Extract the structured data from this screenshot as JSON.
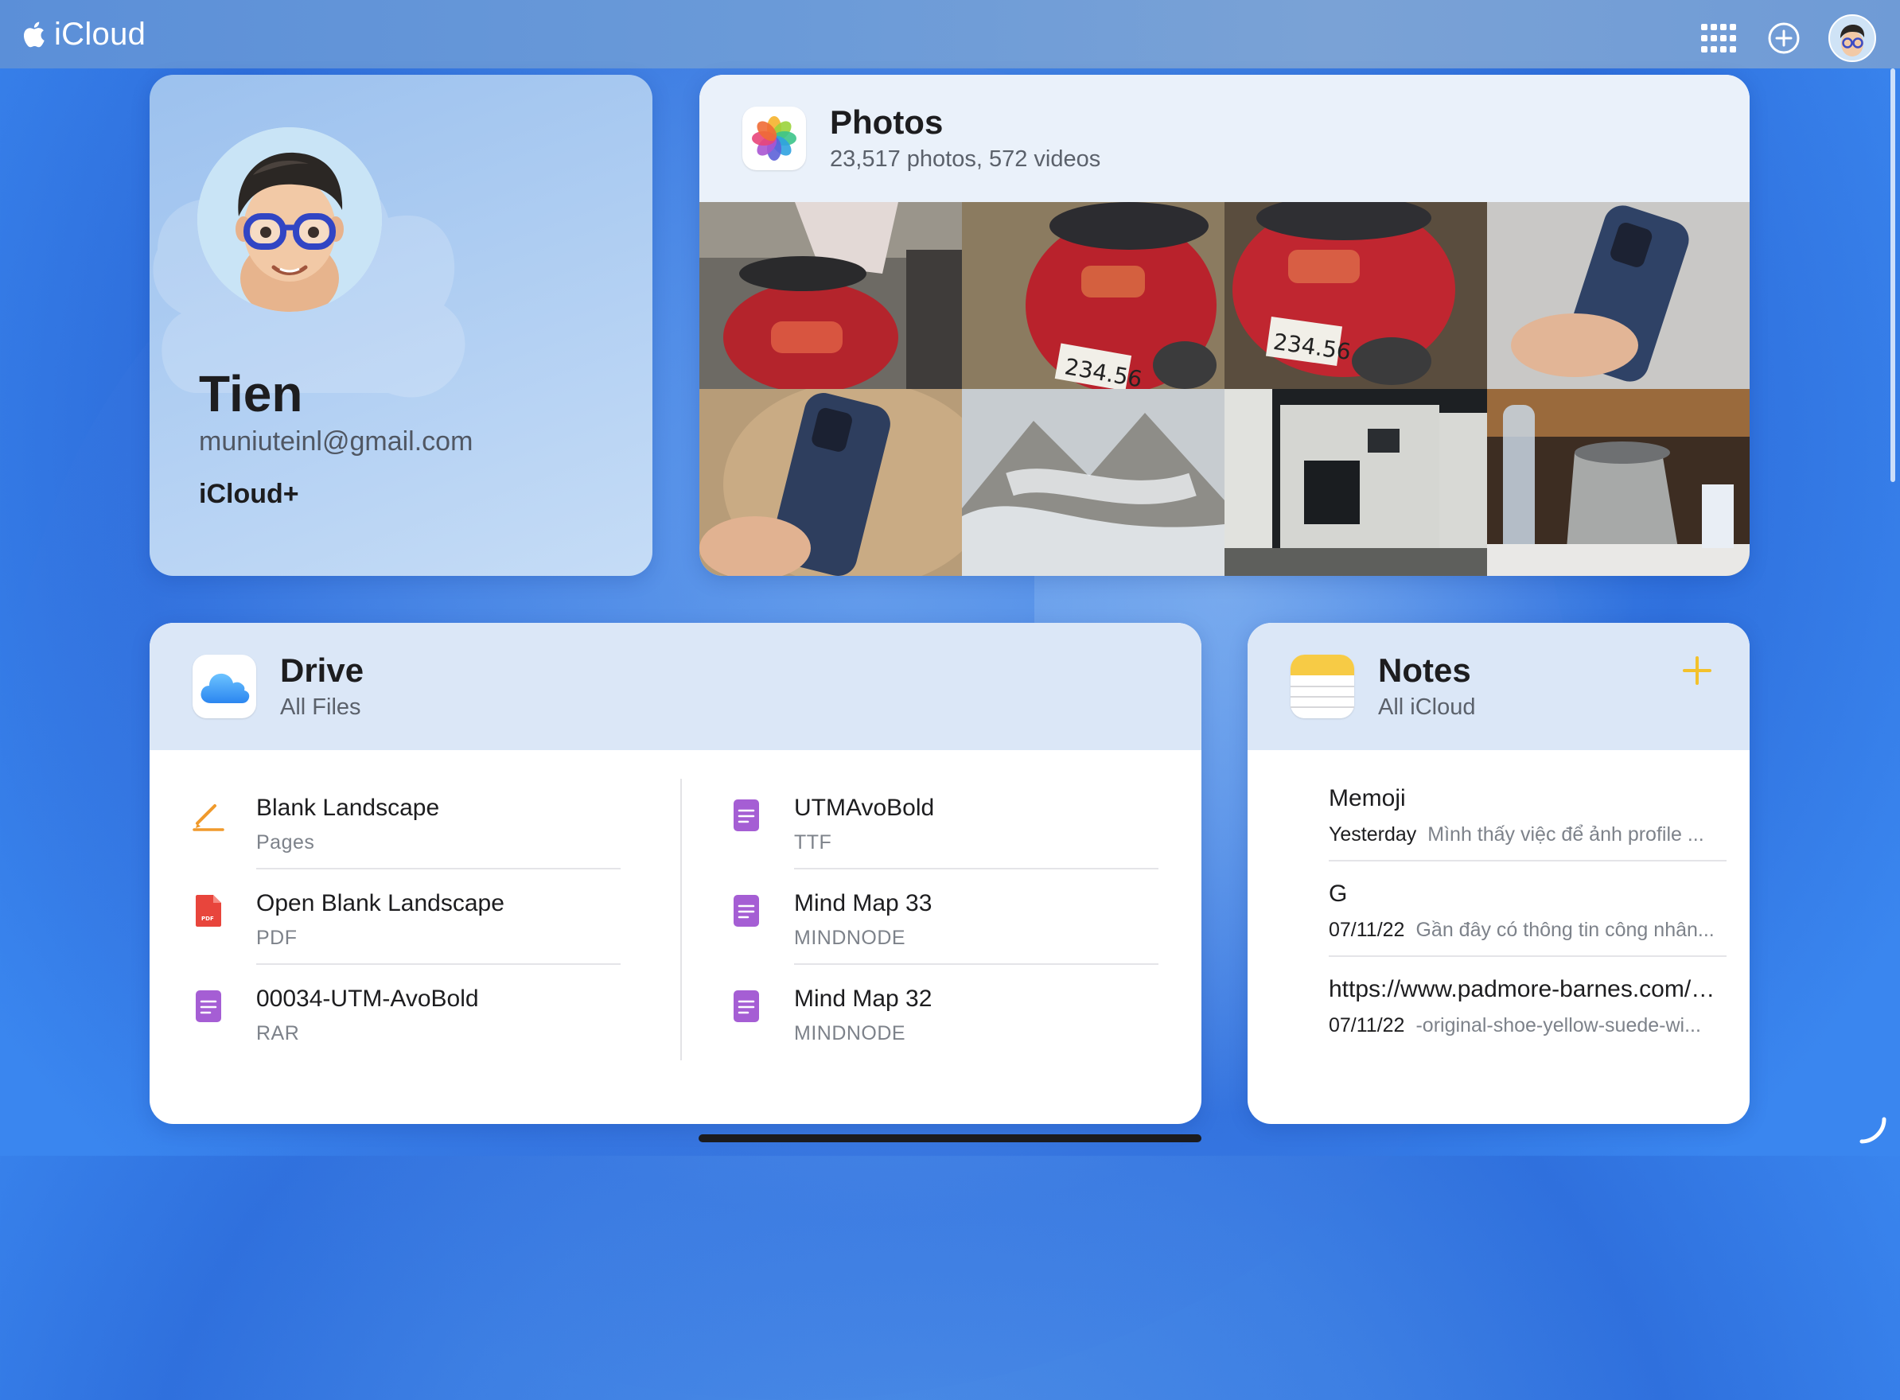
{
  "colors": {
    "accent_notes": "#f3c12b",
    "pages_orange": "#f09a2c",
    "pdf_red": "#e8453c",
    "doc_purple": "#a55ed4"
  },
  "topbar": {
    "brand_text": "iCloud",
    "icons": [
      "apple-logo-icon",
      "app-grid-icon",
      "add-circle-icon",
      "user-avatar-icon"
    ]
  },
  "profile": {
    "name": "Tien",
    "email": "muniuteinl@gmail.com",
    "plan": "iCloud+"
  },
  "photos": {
    "title": "Photos",
    "subtitle": "23,517 photos, 572 videos",
    "thumbnails": [
      {
        "subject": "scooter-rear",
        "plate": ""
      },
      {
        "subject": "scooter-rear",
        "plate": "234.56"
      },
      {
        "subject": "scooter-rear",
        "plate": "234.56"
      },
      {
        "subject": "phone-in-hand",
        "plate": ""
      },
      {
        "subject": "phone-in-hand",
        "plate": ""
      },
      {
        "subject": "misty-mountain",
        "plate": ""
      },
      {
        "subject": "house-night",
        "plate": ""
      },
      {
        "subject": "kettle-table",
        "plate": ""
      }
    ]
  },
  "drive": {
    "title": "Drive",
    "subtitle": "All Files",
    "left_files": [
      {
        "name": "Blank Landscape",
        "type": "Pages",
        "icon": "pages-pencil-icon"
      },
      {
        "name": "Open Blank Landscape",
        "type": "PDF",
        "icon": "pdf-file-icon"
      },
      {
        "name": "00034-UTM-AvoBold",
        "type": "RAR",
        "icon": "document-icon"
      }
    ],
    "right_files": [
      {
        "name": "UTMAvoBold",
        "type": "TTF",
        "icon": "document-icon"
      },
      {
        "name": "Mind Map 33",
        "type": "MINDNODE",
        "icon": "document-icon"
      },
      {
        "name": "Mind Map 32",
        "type": "MINDNODE",
        "icon": "document-icon"
      }
    ]
  },
  "notes": {
    "title": "Notes",
    "subtitle": "All iCloud",
    "items": [
      {
        "title": "Memoji",
        "date": "Yesterday",
        "snippet": "Mình thấy việc để ảnh profile ..."
      },
      {
        "title": "G",
        "date": "07/11/22",
        "snippet": "Gần đây có thông tin công nhân..."
      },
      {
        "title": "https://www.padmore-barnes.com/s...",
        "date": "07/11/22",
        "snippet": "-original-shoe-yellow-suede-wi..."
      }
    ]
  }
}
